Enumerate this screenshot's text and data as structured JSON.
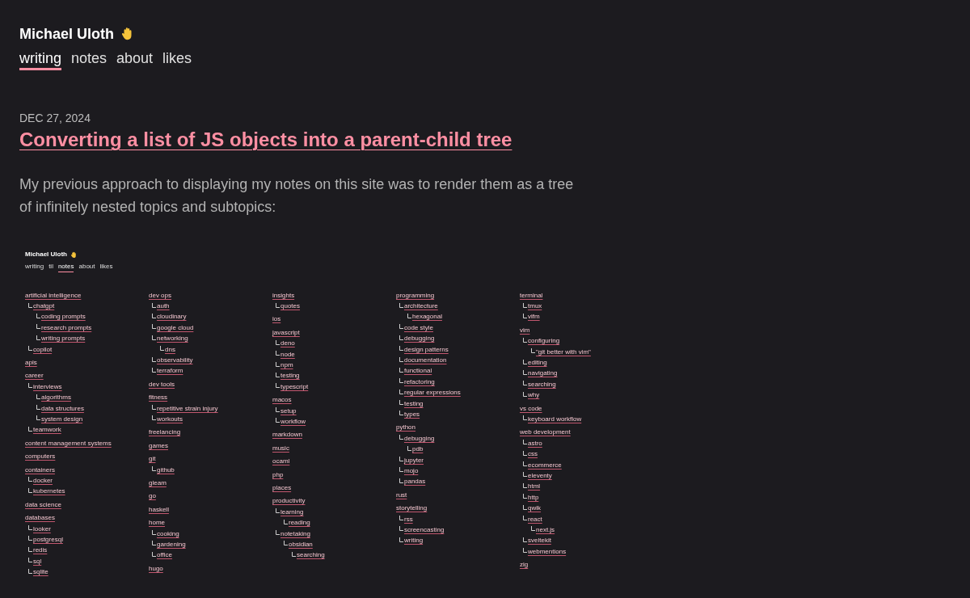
{
  "site": {
    "title": "Michael Uloth"
  },
  "nav": [
    {
      "label": "writing",
      "selected": true
    },
    {
      "label": "notes",
      "selected": false
    },
    {
      "label": "about",
      "selected": false
    },
    {
      "label": "likes",
      "selected": false
    }
  ],
  "post": {
    "date": "DEC 27, 2024",
    "title": "Converting a list of JS objects into a parent-child tree",
    "intro": "My previous approach to displaying my notes on this site was to render them as a tree of infinitely nested topics and subtopics:"
  },
  "screenshot": {
    "site_title": "Michael Uloth",
    "nav": [
      {
        "label": "writing",
        "selected": false
      },
      {
        "label": "til",
        "selected": false
      },
      {
        "label": "notes",
        "selected": true
      },
      {
        "label": "about",
        "selected": false
      },
      {
        "label": "likes",
        "selected": false
      }
    ],
    "columns": [
      [
        {
          "label": "artificial intelligence",
          "children": [
            {
              "label": "chatgpt",
              "children": [
                {
                  "label": "coding prompts"
                },
                {
                  "label": "research prompts"
                },
                {
                  "label": "writing prompts"
                }
              ]
            },
            {
              "label": "copilot"
            }
          ]
        },
        {
          "label": "apis"
        },
        {
          "label": "career",
          "children": [
            {
              "label": "interviews",
              "children": [
                {
                  "label": "algorithms"
                },
                {
                  "label": "data structures"
                },
                {
                  "label": "system design"
                }
              ]
            },
            {
              "label": "teamwork"
            }
          ]
        },
        {
          "label": "content management systems"
        },
        {
          "label": "computers"
        },
        {
          "label": "containers",
          "children": [
            {
              "label": "docker"
            },
            {
              "label": "kubernetes"
            }
          ]
        },
        {
          "label": "data science"
        },
        {
          "label": "databases",
          "children": [
            {
              "label": "looker"
            },
            {
              "label": "postgresql"
            },
            {
              "label": "redis"
            },
            {
              "label": "sql"
            },
            {
              "label": "sqlite"
            }
          ]
        }
      ],
      [
        {
          "label": "dev ops",
          "children": [
            {
              "label": "auth"
            },
            {
              "label": "cloudinary"
            },
            {
              "label": "google cloud"
            },
            {
              "label": "networking",
              "children": [
                {
                  "label": "dns"
                }
              ]
            },
            {
              "label": "observability"
            },
            {
              "label": "terraform"
            }
          ]
        },
        {
          "label": "dev tools"
        },
        {
          "label": "fitness",
          "children": [
            {
              "label": "repetitive strain injury"
            },
            {
              "label": "workouts"
            }
          ]
        },
        {
          "label": "freelancing"
        },
        {
          "label": "games"
        },
        {
          "label": "git",
          "children": [
            {
              "label": "github"
            }
          ]
        },
        {
          "label": "gleam"
        },
        {
          "label": "go"
        },
        {
          "label": "haskell"
        },
        {
          "label": "home",
          "children": [
            {
              "label": "cooking"
            },
            {
              "label": "gardening"
            },
            {
              "label": "office"
            }
          ]
        },
        {
          "label": "hugo"
        }
      ],
      [
        {
          "label": "insights",
          "children": [
            {
              "label": "quotes"
            }
          ]
        },
        {
          "label": "ios"
        },
        {
          "label": "javascript",
          "children": [
            {
              "label": "deno"
            },
            {
              "label": "node"
            },
            {
              "label": "npm"
            },
            {
              "label": "testing"
            },
            {
              "label": "typescript"
            }
          ]
        },
        {
          "label": "macos",
          "children": [
            {
              "label": "setup"
            },
            {
              "label": "workflow"
            }
          ]
        },
        {
          "label": "markdown"
        },
        {
          "label": "music"
        },
        {
          "label": "ocaml"
        },
        {
          "label": "php"
        },
        {
          "label": "places"
        },
        {
          "label": "productivity",
          "children": [
            {
              "label": "learning",
              "children": [
                {
                  "label": "reading"
                }
              ]
            },
            {
              "label": "notetaking",
              "children": [
                {
                  "label": "obsidian",
                  "children": [
                    {
                      "label": "searching"
                    }
                  ]
                }
              ]
            }
          ]
        }
      ],
      [
        {
          "label": "programming",
          "children": [
            {
              "label": "architecture",
              "children": [
                {
                  "label": "hexagonal"
                }
              ]
            },
            {
              "label": "code style"
            },
            {
              "label": "debugging"
            },
            {
              "label": "design patterns"
            },
            {
              "label": "documentation"
            },
            {
              "label": "functional"
            },
            {
              "label": "refactoring"
            },
            {
              "label": "regular expressions"
            },
            {
              "label": "testing"
            },
            {
              "label": "types"
            }
          ]
        },
        {
          "label": "python",
          "children": [
            {
              "label": "debugging",
              "children": [
                {
                  "label": "pdb"
                }
              ]
            },
            {
              "label": "jupyter"
            },
            {
              "label": "mojo"
            },
            {
              "label": "pandas"
            }
          ]
        },
        {
          "label": "rust"
        },
        {
          "label": "storytelling",
          "children": [
            {
              "label": "rss"
            },
            {
              "label": "screencasting"
            },
            {
              "label": "writing"
            }
          ]
        }
      ],
      [
        {
          "label": "terminal",
          "children": [
            {
              "label": "tmux"
            },
            {
              "label": "vifm"
            }
          ]
        },
        {
          "label": "vim",
          "children": [
            {
              "label": "configuring",
              "children": [
                {
                  "label": "\"git better with vim\""
                }
              ]
            },
            {
              "label": "editing"
            },
            {
              "label": "navigating"
            },
            {
              "label": "searching"
            },
            {
              "label": "why"
            }
          ]
        },
        {
          "label": "vs code",
          "children": [
            {
              "label": "keyboard workflow"
            }
          ]
        },
        {
          "label": "web development",
          "children": [
            {
              "label": "astro"
            },
            {
              "label": "css"
            },
            {
              "label": "ecommerce"
            },
            {
              "label": "eleventy"
            },
            {
              "label": "html"
            },
            {
              "label": "http"
            },
            {
              "label": "qwik"
            },
            {
              "label": "react",
              "children": [
                {
                  "label": "next.js"
                }
              ]
            },
            {
              "label": "sveltekit"
            },
            {
              "label": "webmentions"
            }
          ]
        },
        {
          "label": "zig"
        }
      ]
    ]
  }
}
